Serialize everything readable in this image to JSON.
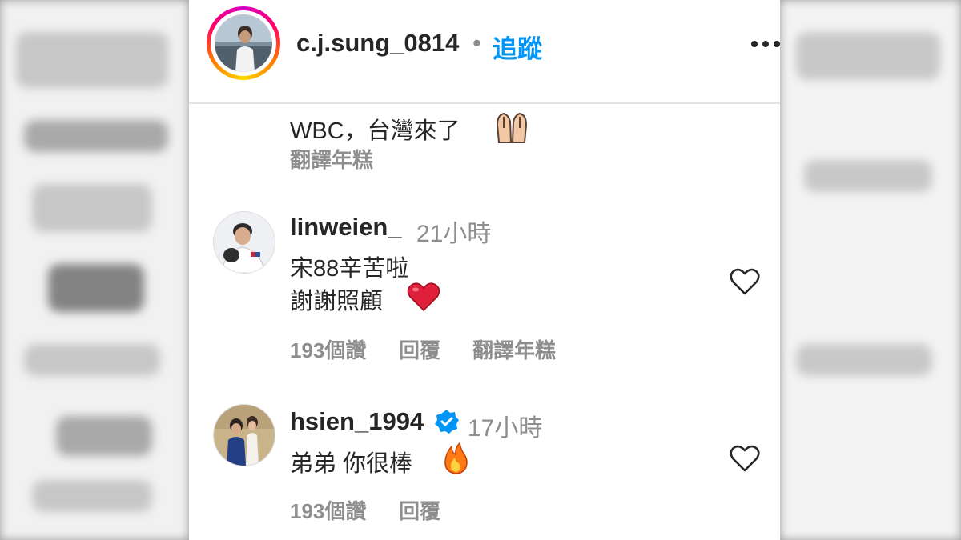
{
  "post": {
    "username": "c.j.sung_0814",
    "separator": "•",
    "follow_label": "追蹤",
    "more_icon": "more-horizontal-icon"
  },
  "caption": {
    "text": "WBC，台灣來了",
    "emoji": "pray-icon",
    "translate_label": "翻譯年糕"
  },
  "comments": [
    {
      "username": "linweien_",
      "time": "21小時",
      "lines": [
        "宋88辛苦啦",
        "謝謝照顧"
      ],
      "emoji": "red-heart-icon",
      "likes": "193個讚",
      "reply_label": "回覆",
      "translate_label": "翻譯年糕"
    },
    {
      "username": "hsien_1994",
      "verified": true,
      "time": "17小時",
      "lines": [
        "弟弟 你很棒"
      ],
      "emoji": "fire-icon",
      "likes": "193個讚",
      "reply_label": "回覆"
    }
  ],
  "colors": {
    "accent": "#0095f6",
    "muted": "#8e8e8e",
    "text": "#262626",
    "heart": "#e0203a"
  }
}
